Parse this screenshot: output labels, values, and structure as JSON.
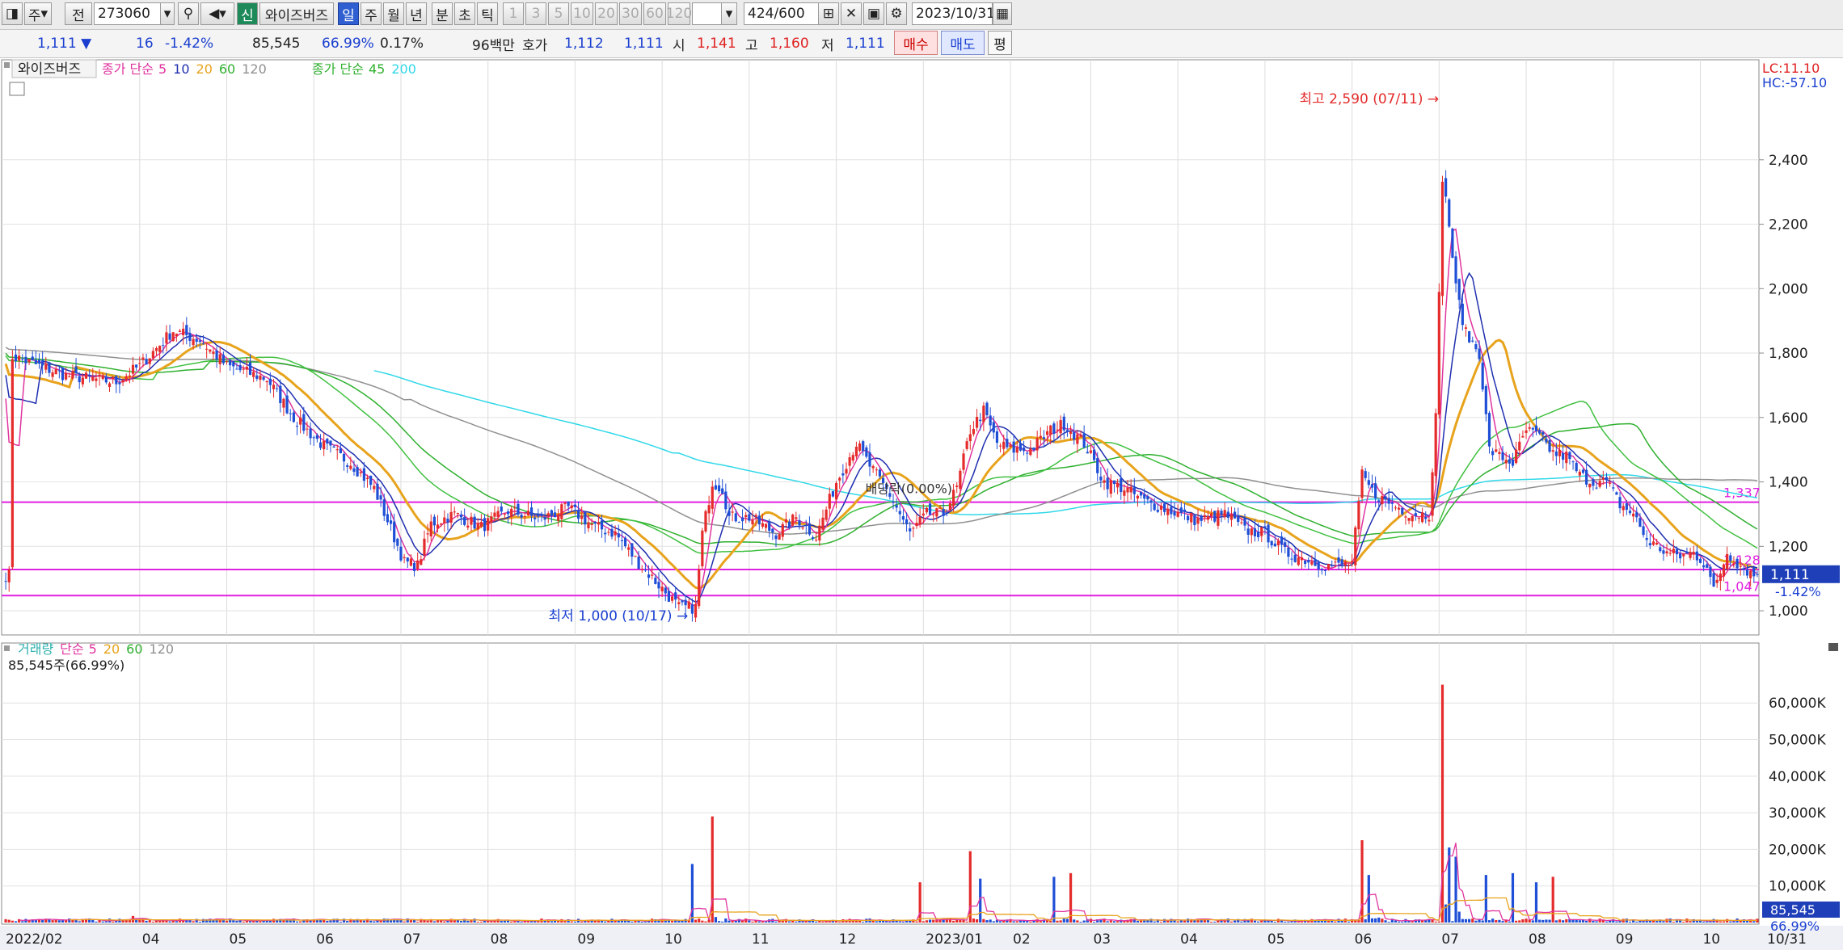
{
  "toolbar": {
    "period_label": "주",
    "prev_label": "전",
    "code": "273060",
    "name": "와이즈버즈",
    "credit": "신",
    "day": "일",
    "week": "주",
    "month": "월",
    "year": "년",
    "minute": "분",
    "second": "초",
    "tick": "틱",
    "intervals": [
      "1",
      "3",
      "5",
      "10",
      "20",
      "30",
      "60",
      "120"
    ],
    "count": "424",
    "count_total": "/600",
    "date": "2023/10/31"
  },
  "quote": {
    "price": "1,111",
    "arrow": "▼",
    "change": "16",
    "change_pct": "-1.42%",
    "volume": "85,545",
    "volume_ratio": "66.99%",
    "turnover": "0.17%",
    "amount": "96백만",
    "ask_label": "호가",
    "ask1": "1,112",
    "ask2": "1,111",
    "open_label": "시",
    "open": "1,141",
    "high_label": "고",
    "high": "1,160",
    "low_label": "저",
    "low": "1,111",
    "buy": "매수",
    "sell": "매도",
    "even": "평"
  },
  "legend": {
    "name": "와이즈버즈",
    "ma_label": "종가 단순",
    "ma_periods": [
      "5",
      "10",
      "20",
      "60",
      "120"
    ],
    "ma2_label": "종가 단순",
    "ma2_periods": [
      "45",
      "200"
    ],
    "vol_label": "거래량",
    "vol_ma_label": "단순",
    "vol_ma_periods": [
      "5",
      "20",
      "60",
      "120"
    ],
    "vol_value": "85,545주(66.99%)"
  },
  "colors": {
    "up": "#e52b2b",
    "down": "#1f4fd6",
    "ma5": "#e0359f",
    "ma10": "#1f2fb0",
    "ma20": "#e8a31c",
    "ma60": "#2fb02f",
    "ma120": "#909090",
    "ma45": "#40c040",
    "ma200": "#30d8e8",
    "hline": "#e020e0"
  },
  "chart_data": {
    "type": "candlestick",
    "date_range": [
      "2022/02",
      "2023/10/31"
    ],
    "x_ticks": [
      "2022/02",
      "04",
      "05",
      "06",
      "07",
      "08",
      "09",
      "10",
      "11",
      "12",
      "2023/01",
      "02",
      "03",
      "04",
      "05",
      "06",
      "07",
      "08",
      "09",
      "10",
      "10/31"
    ],
    "y_ticks": [
      "2,400",
      "2,200",
      "2,000",
      "1,800",
      "1,600",
      "1,400",
      "1,200",
      "1,000"
    ],
    "y_range": [
      960,
      2560
    ],
    "price_path": [
      [
        2,
        1790
      ],
      [
        18,
        1730
      ],
      [
        33,
        1710
      ],
      [
        40,
        1760
      ],
      [
        50,
        1870
      ],
      [
        58,
        1840
      ],
      [
        66,
        1760
      ],
      [
        78,
        1720
      ],
      [
        86,
        1600
      ],
      [
        95,
        1510
      ],
      [
        103,
        1460
      ],
      [
        110,
        1380
      ],
      [
        114,
        1280
      ],
      [
        119,
        1150
      ],
      [
        123,
        1140
      ],
      [
        127,
        1270
      ],
      [
        134,
        1300
      ],
      [
        142,
        1260
      ],
      [
        150,
        1310
      ],
      [
        160,
        1285
      ],
      [
        168,
        1320
      ],
      [
        176,
        1260
      ],
      [
        182,
        1240
      ],
      [
        188,
        1160
      ],
      [
        195,
        1080
      ],
      [
        201,
        1010
      ],
      [
        206,
        1010
      ],
      [
        208,
        1240
      ],
      [
        211,
        1400
      ],
      [
        214,
        1380
      ],
      [
        216,
        1290
      ],
      [
        222,
        1290
      ],
      [
        230,
        1240
      ],
      [
        236,
        1290
      ],
      [
        242,
        1230
      ],
      [
        248,
        1400
      ],
      [
        254,
        1520
      ],
      [
        258,
        1450
      ],
      [
        264,
        1360
      ],
      [
        270,
        1240
      ],
      [
        275,
        1300
      ],
      [
        280,
        1300
      ],
      [
        284,
        1380
      ],
      [
        288,
        1560
      ],
      [
        292,
        1620
      ],
      [
        296,
        1520
      ],
      [
        300,
        1500
      ],
      [
        306,
        1500
      ],
      [
        312,
        1560
      ],
      [
        316,
        1580
      ],
      [
        322,
        1520
      ],
      [
        328,
        1400
      ],
      [
        334,
        1380
      ],
      [
        340,
        1340
      ],
      [
        348,
        1310
      ],
      [
        356,
        1280
      ],
      [
        364,
        1300
      ],
      [
        370,
        1250
      ],
      [
        376,
        1240
      ],
      [
        382,
        1180
      ],
      [
        388,
        1160
      ],
      [
        394,
        1140
      ],
      [
        398,
        1140
      ],
      [
        402,
        1150
      ],
      [
        405,
        1420
      ],
      [
        408,
        1370
      ],
      [
        412,
        1340
      ],
      [
        416,
        1320
      ],
      [
        420,
        1300
      ],
      [
        425,
        1300
      ],
      [
        427,
        1600
      ],
      [
        429,
        2350
      ],
      [
        431,
        2200
      ],
      [
        433,
        2000
      ],
      [
        436,
        1860
      ],
      [
        440,
        1800
      ],
      [
        443,
        1500
      ],
      [
        446,
        1480
      ],
      [
        450,
        1460
      ],
      [
        454,
        1560
      ],
      [
        458,
        1540
      ],
      [
        462,
        1490
      ],
      [
        466,
        1480
      ],
      [
        470,
        1420
      ],
      [
        474,
        1400
      ],
      [
        478,
        1400
      ],
      [
        482,
        1330
      ],
      [
        486,
        1300
      ],
      [
        490,
        1220
      ],
      [
        496,
        1180
      ],
      [
        500,
        1170
      ],
      [
        504,
        1180
      ],
      [
        508,
        1140
      ],
      [
        510,
        1060
      ],
      [
        512,
        1120
      ],
      [
        514,
        1180
      ],
      [
        518,
        1140
      ],
      [
        522,
        1111
      ]
    ],
    "annotations": [
      {
        "label": "최고 2,590 (07/11)",
        "date": "2023/07/11",
        "value": 2590
      },
      {
        "label": "최저 1,000 (10/17)",
        "date": "2022/10/17",
        "value": 1000
      },
      {
        "label": "배당락(0.00%)",
        "date": "2023/01"
      }
    ],
    "hlines": [
      {
        "value": 1337,
        "label": "1,337"
      },
      {
        "value": 1128,
        "label": "1,128"
      },
      {
        "value": 1047,
        "label": "1,047"
      }
    ],
    "last": {
      "price": "1,111",
      "pct": "-1.42%"
    },
    "corner": {
      "lc": "LC:11.10",
      "hc": "HC:-57.10"
    },
    "volume": {
      "y_ticks": [
        "60,000K",
        "50,000K",
        "40,000K",
        "30,000K",
        "20,000K",
        "10,000K"
      ],
      "y_max": 68000,
      "last_value": "85,545",
      "last_pct": "66.99%",
      "spikes": [
        [
          38,
          1800
        ],
        [
          205,
          16000
        ],
        [
          211,
          29000
        ],
        [
          273,
          11000
        ],
        [
          288,
          19500
        ],
        [
          291,
          12000
        ],
        [
          313,
          12500
        ],
        [
          318,
          13500
        ],
        [
          405,
          22500
        ],
        [
          407,
          13000
        ],
        [
          429,
          65000
        ],
        [
          431,
          20500
        ],
        [
          433,
          18000
        ],
        [
          442,
          13000
        ],
        [
          450,
          13500
        ],
        [
          457,
          11000
        ],
        [
          462,
          12500
        ]
      ]
    }
  }
}
